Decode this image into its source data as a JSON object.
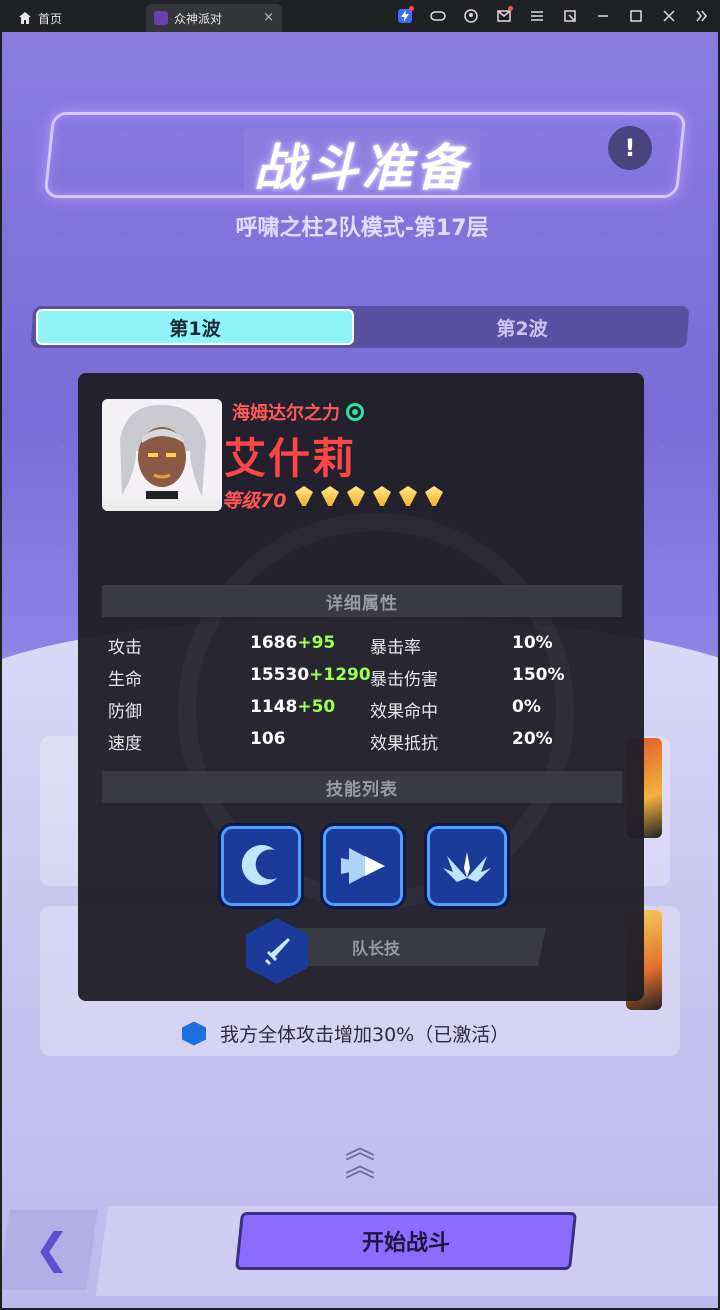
{
  "browser": {
    "home_tab": "首页",
    "active_tab": "众神派对",
    "close_glyph": "×",
    "toolbar_icons": [
      "lightning-icon",
      "gamepad-icon",
      "user-icon",
      "mail-icon",
      "menu-icon",
      "popout-icon",
      "minimize-icon",
      "maximize-icon",
      "close-icon",
      "more-icon"
    ]
  },
  "game": {
    "title": "战斗准备",
    "info_glyph": "!",
    "subtitle": "呼啸之柱2队模式-第17层",
    "waves": [
      "第1波",
      "第2波"
    ],
    "hero": {
      "faction": "海姆达尔之力",
      "name": "艾什莉",
      "level": "等级70",
      "stars": 6,
      "detail_header": "详细属性",
      "stats": [
        {
          "label": "攻击",
          "base": "1686",
          "bonus": "+95"
        },
        {
          "label": "生命",
          "base": "15530",
          "bonus": "+1290"
        },
        {
          "label": "防御",
          "base": "1148",
          "bonus": "+50"
        },
        {
          "label": "速度",
          "base": "106",
          "bonus": ""
        }
      ],
      "stats2": [
        {
          "label": "暴击率",
          "value": "10%"
        },
        {
          "label": "暴击伤害",
          "value": "150%"
        },
        {
          "label": "效果命中",
          "value": "0%"
        },
        {
          "label": "效果抵抗",
          "value": "20%"
        }
      ],
      "skills_header": "技能列表",
      "leader_skill_label": "队长技"
    },
    "leader_bonus": "我方全体攻击增加30%（已激活）",
    "start_button": "开始战斗",
    "back_glyph": "❮"
  }
}
